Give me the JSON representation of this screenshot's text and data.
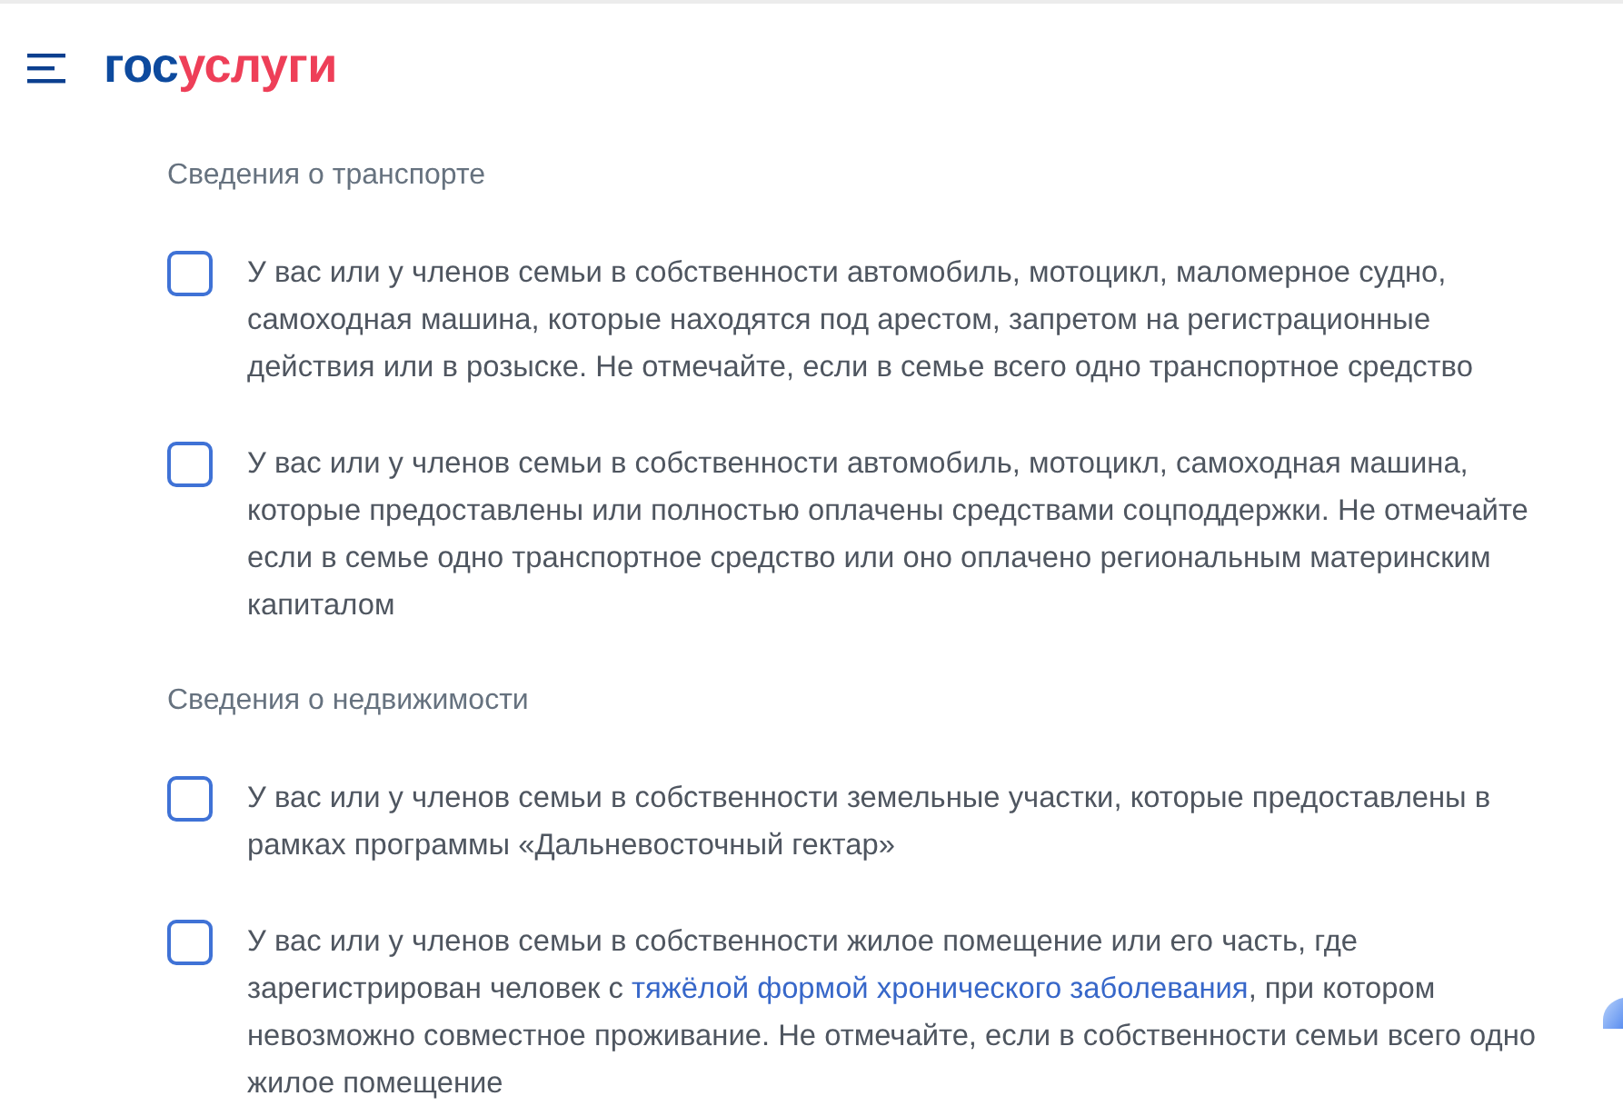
{
  "header": {
    "logo": {
      "first_part": "гос",
      "second_part": "услуги"
    }
  },
  "sections": [
    {
      "title": "Сведения о транспорте",
      "items": [
        {
          "checked": false,
          "lines": [
            [
              {
                "kind": "text",
                "text": "У вас или у членов семьи в собственности автомобиль, мотоцикл, маломерное судно,"
              }
            ],
            [
              {
                "kind": "text",
                "text": "самоходная машина, которые находятся под арестом, запретом на регистрационные"
              }
            ],
            [
              {
                "kind": "text",
                "text": "действия или в розыске. Не отмечайте, если в семье всего одно транспортное средство"
              }
            ]
          ]
        },
        {
          "checked": false,
          "lines": [
            [
              {
                "kind": "text",
                "text": "У вас или у членов семьи в собственности автомобиль, мотоцикл, самоходная машина,"
              }
            ],
            [
              {
                "kind": "text",
                "text": "которые предоставлены или полностью оплачены средствами соцподдержки. Не отмечайте"
              }
            ],
            [
              {
                "kind": "text",
                "text": "если в семье одно транспортное средство или оно оплачено региональным материнским"
              }
            ],
            [
              {
                "kind": "text",
                "text": "капиталом"
              }
            ]
          ]
        }
      ]
    },
    {
      "title": "Сведения о недвижимости",
      "items": [
        {
          "checked": false,
          "lines": [
            [
              {
                "kind": "text",
                "text": "У вас или у членов семьи в собственности земельные участки, которые предоставлены в"
              }
            ],
            [
              {
                "kind": "text",
                "text": "рамках программы «Дальневосточный гектар»"
              }
            ]
          ]
        },
        {
          "checked": false,
          "lines": [
            [
              {
                "kind": "text",
                "text": "У вас или у членов семьи в собственности жилое помещение или его часть, где"
              }
            ],
            [
              {
                "kind": "text",
                "text": "зарегистрирован человек с "
              },
              {
                "kind": "link",
                "text": "тяжёлой формой хронического заболевания"
              },
              {
                "kind": "text",
                "text": ", при котором"
              }
            ],
            [
              {
                "kind": "text",
                "text": "невозможно совместное проживание. Не отмечайте, если в собственности семьи всего одно"
              }
            ],
            [
              {
                "kind": "text",
                "text": "жилое помещение"
              }
            ]
          ]
        }
      ]
    }
  ]
}
